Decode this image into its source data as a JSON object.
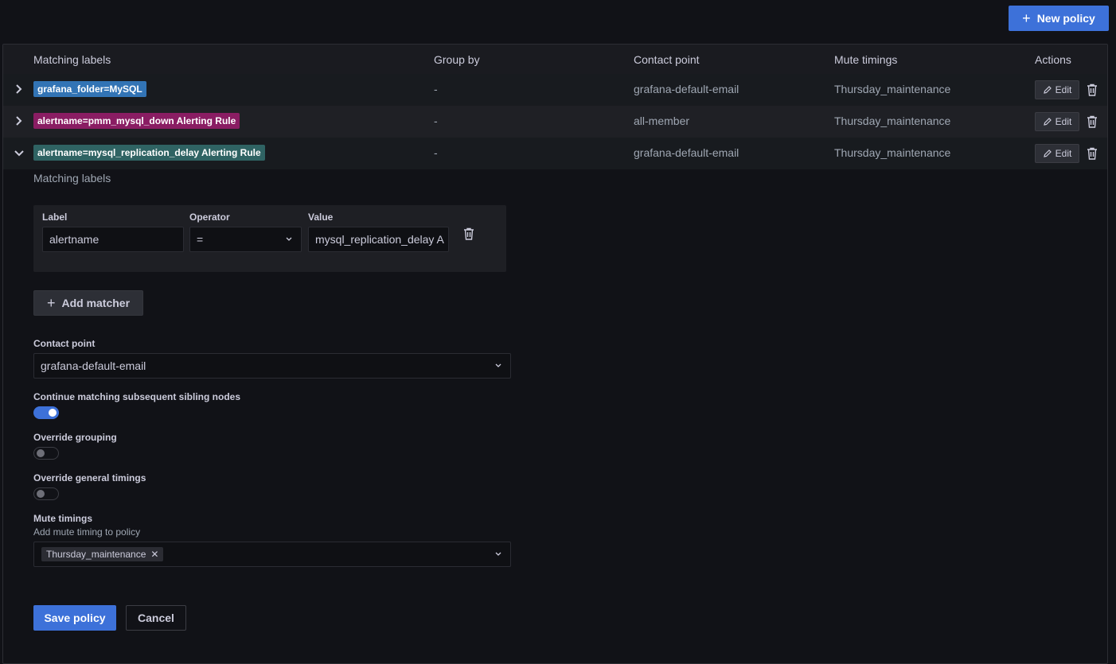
{
  "toolbar": {
    "new_policy_label": "New policy"
  },
  "table": {
    "headers": [
      "Matching labels",
      "Group by",
      "Contact point",
      "Mute timings",
      "Actions"
    ],
    "edit_label": "Edit",
    "rows": [
      {
        "label": "grafana_folder=MySQL",
        "tag_color": "#3274b5",
        "group_by": "-",
        "contact_point": "grafana-default-email",
        "mute_timings": "Thursday_maintenance",
        "expanded": false
      },
      {
        "label": "alertname=pmm_mysql_down Alerting Rule",
        "tag_color": "#8a1d63",
        "group_by": "-",
        "contact_point": "all-member",
        "mute_timings": "Thursday_maintenance",
        "expanded": false
      },
      {
        "label": "alertname=mysql_replication_delay Alerting Rule",
        "tag_color": "#2f6363",
        "group_by": "-",
        "contact_point": "grafana-default-email",
        "mute_timings": "Thursday_maintenance",
        "expanded": true
      }
    ]
  },
  "editor": {
    "matching_labels_title": "Matching labels",
    "matcher": {
      "label_header": "Label",
      "operator_header": "Operator",
      "value_header": "Value",
      "label_value": "alertname",
      "operator_value": "=",
      "value_value": "mysql_replication_delay A"
    },
    "add_matcher_label": "Add matcher",
    "contact_point_label": "Contact point",
    "contact_point_value": "grafana-default-email",
    "continue_label": "Continue matching subsequent sibling nodes",
    "continue_on": true,
    "override_grouping_label": "Override grouping",
    "override_grouping_on": false,
    "override_timings_label": "Override general timings",
    "override_timings_on": false,
    "mute_timings_label": "Mute timings",
    "mute_timings_desc": "Add mute timing to policy",
    "mute_timing_chip": "Thursday_maintenance",
    "save_label": "Save policy",
    "cancel_label": "Cancel"
  },
  "colors": {
    "accent": "#3d71d9",
    "background": "#111217"
  }
}
